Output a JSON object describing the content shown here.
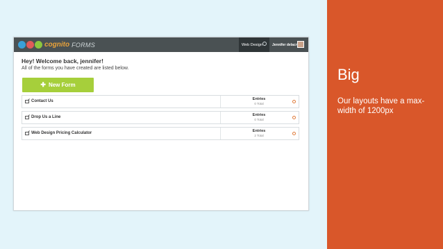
{
  "slide": {
    "title": "Big",
    "subtitle": "Our layouts have a max-width of 1200px",
    "accent_color": "#d9572a",
    "background_color": "#e3f4fa"
  },
  "app": {
    "logo_forms": "FORMS",
    "nav": {
      "section": "Web Design",
      "user": "Jennifer delacruz"
    },
    "welcome": "Hey! Welcome back, jennifer!",
    "description": "All of the forms you have created are listed below.",
    "new_form_label": "New Form",
    "forms": [
      {
        "name": "Contact Us",
        "entries_label": "Entries",
        "entries_total": "0 Total"
      },
      {
        "name": "Drop Us a Line",
        "entries_label": "Entries",
        "entries_total": "0 Total"
      },
      {
        "name": "Web Design Pricing Calculator",
        "entries_label": "Entries",
        "entries_total": "2 Total"
      }
    ],
    "colors": {
      "topbar": "#4a5153",
      "new_button": "#a6cf3b",
      "gear": "#e07b39"
    }
  }
}
